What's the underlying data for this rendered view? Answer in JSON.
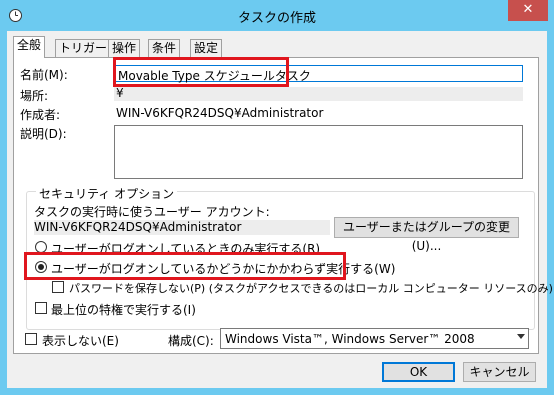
{
  "window": {
    "title": "タスクの作成"
  },
  "tabs": [
    "全般",
    "トリガー",
    "操作",
    "条件",
    "設定"
  ],
  "general": {
    "name_label": "名前(M):",
    "name_value": "Movable Type スケジュールタスク",
    "location_label": "場所:",
    "location_value": "¥",
    "author_label": "作成者:",
    "author_value": "WIN-V6KFQR24DSQ¥Administrator",
    "description_label": "説明(D):",
    "description_value": ""
  },
  "security": {
    "group_title": "セキュリティ オプション",
    "account_prompt": "タスクの実行時に使うユーザー アカウント:",
    "account_value": "WIN-V6KFQR24DSQ¥Administrator",
    "change_button": "ユーザーまたはグループの変更(U)...",
    "radio_logged_on": "ユーザーがログオンしているときのみ実行する(R)",
    "radio_whether": "ユーザーがログオンしているかどうかにかかわらず実行する(W)",
    "no_store_password": "パスワードを保存しない(P) (タスクがアクセスできるのはローカル コンピューター リソースのみ)",
    "highest_privileges": "最上位の特権で実行する(I)"
  },
  "footer": {
    "hidden_label": "表示しない(E)",
    "configure_label": "構成(C):",
    "configure_value": "Windows Vista™, Windows Server™ 2008",
    "ok": "OK",
    "cancel": "キャンセル"
  }
}
